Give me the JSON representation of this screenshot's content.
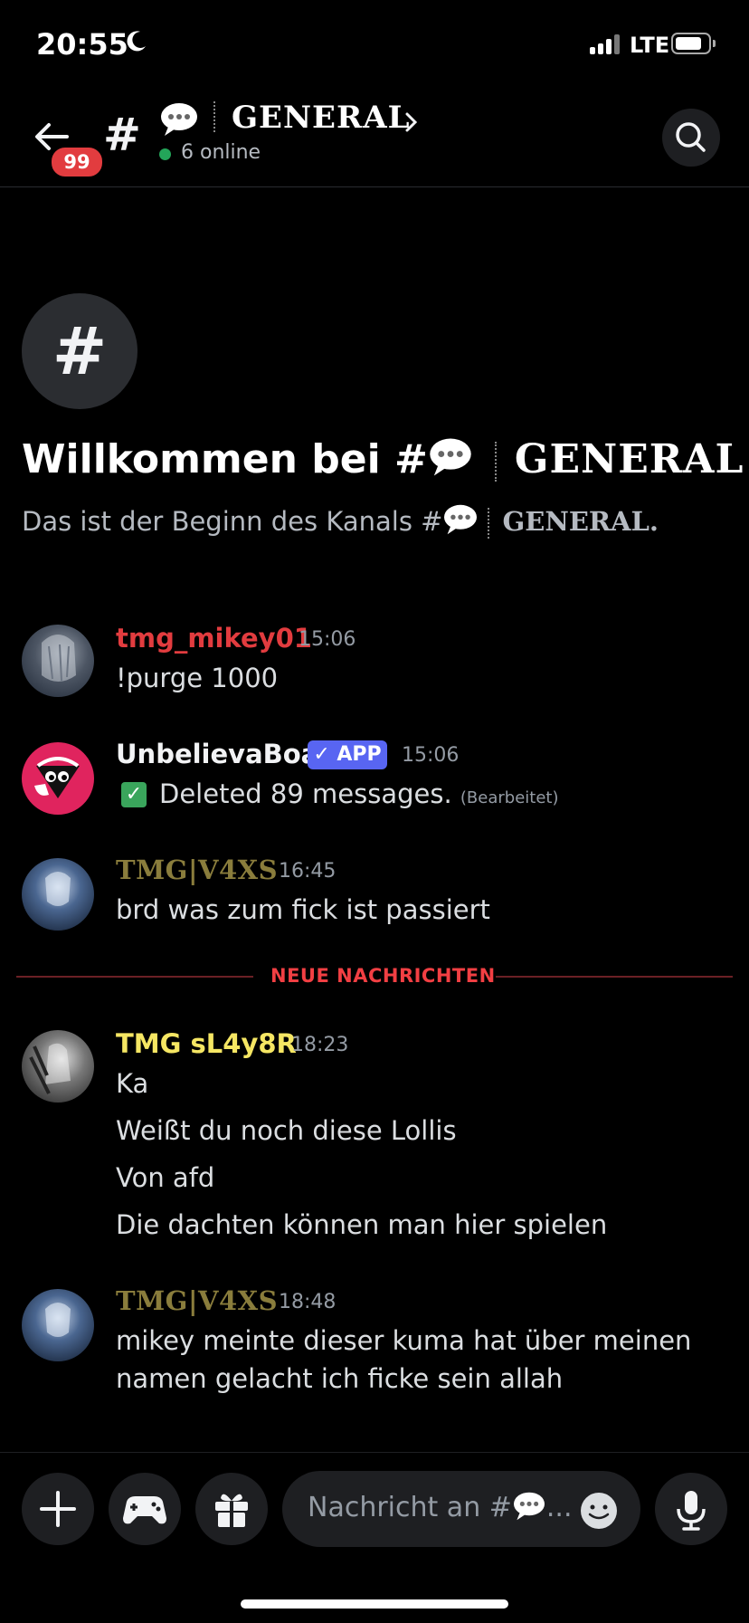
{
  "status_bar": {
    "time": "20:55",
    "network": "LTE"
  },
  "header": {
    "unread_badge": "99",
    "channel_hash": "#",
    "channel_name": "GENERAL",
    "online_count": "6 online"
  },
  "intro": {
    "icon_glyph": "#",
    "welcome_prefix": "Willkommen bei #",
    "channel_name": "GENERAL!",
    "description_prefix": "Das ist der Beginn des Kanals #",
    "description_channel": "GENERAL."
  },
  "messages": [
    {
      "author": "tmg_mikey01",
      "time": "15:06",
      "lines": [
        "!purge 1000"
      ],
      "color": "#e23c3f"
    },
    {
      "author": "UnbelievaBoat",
      "tag": "APP",
      "time": "15:06",
      "lines": [
        "Deleted 89 messages."
      ],
      "edited": "(Bearbeitet)",
      "color": "#f2f3f5"
    },
    {
      "author": "TMG|V4XS",
      "time": "16:45",
      "lines": [
        "brd was zum fick ist passiert"
      ],
      "color": "#8a7d3c"
    },
    {
      "author": "TMG sL4y8R",
      "time": "18:23",
      "lines": [
        "Ka",
        "Weißt du noch diese Lollis",
        "Von afd",
        "Die dachten können man hier spielen"
      ],
      "color": "#f5e663"
    },
    {
      "author": "TMG|V4XS",
      "time": "18:48",
      "lines": [
        "mikey meinte dieser kuma hat über meinen",
        "namen gelacht ich ficke sein allah"
      ],
      "color": "#8a7d3c"
    }
  ],
  "divider": {
    "label": "NEUE NACHRICHTEN"
  },
  "composer": {
    "placeholder_prefix": "Nachricht an #",
    "placeholder_suffix": "..."
  },
  "colors": {
    "background": "#000000",
    "unread_red": "#e23c3f",
    "app_tag": "#5865f2",
    "online_green": "#23a559"
  },
  "icons": [
    "back-arrow-icon",
    "hashtag-icon",
    "speech-bubble-icon",
    "chevron-right-icon",
    "search-icon",
    "plus-icon",
    "gamepad-icon",
    "gift-icon",
    "emoji-icon",
    "microphone-icon"
  ]
}
